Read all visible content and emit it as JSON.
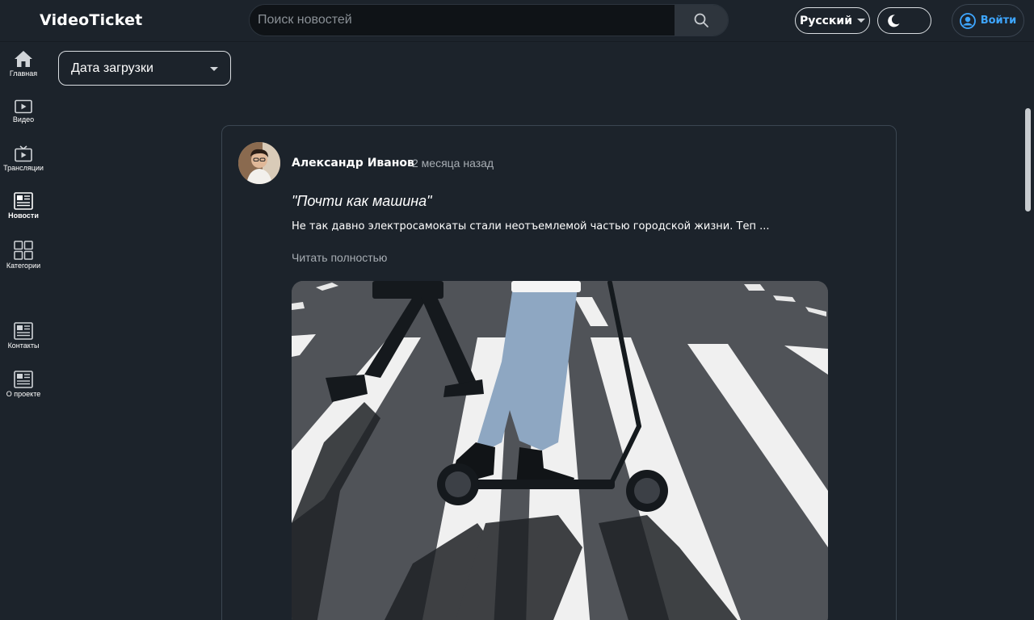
{
  "header": {
    "logo": "VideoTicket",
    "search_placeholder": "Поиск новостей",
    "language": "Русский",
    "login_label": "Войти"
  },
  "sidebar": {
    "items": [
      {
        "label": "Главная",
        "icon": "home-icon"
      },
      {
        "label": "Видео",
        "icon": "video-icon"
      },
      {
        "label": "Трансляции",
        "icon": "tv-icon"
      },
      {
        "label": "Новости",
        "icon": "newspaper-icon",
        "active": true
      },
      {
        "label": "Категории",
        "icon": "grid-icon"
      },
      {
        "label": "Контакты",
        "icon": "newspaper-icon"
      },
      {
        "label": "О проекте",
        "icon": "newspaper-icon"
      }
    ]
  },
  "filters": {
    "sort_selected": "Дата загрузки"
  },
  "post": {
    "author": "Александр Иванов",
    "time_ago": "2 месяца назад",
    "title": "\"Почти как машина\"",
    "excerpt": "Не так давно электросамокаты стали неотъемлемой частью городской жизни. Теп ...",
    "read_more": "Читать полностью"
  },
  "colors": {
    "background": "#1c232b",
    "accent": "#3ea6ff",
    "muted_text": "#a7adb3",
    "card_border": "#3b4651"
  }
}
